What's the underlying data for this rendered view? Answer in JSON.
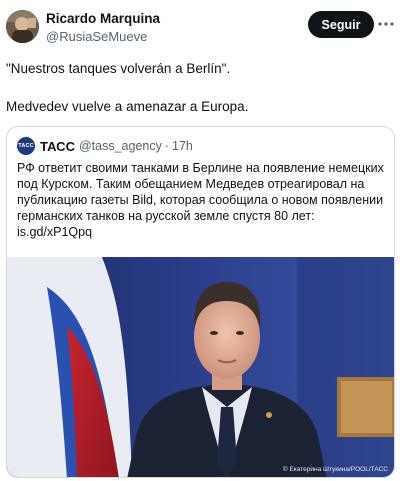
{
  "author": {
    "name": "Ricardo Marquina",
    "handle": "@RusiaSeMueve"
  },
  "follow_button": {
    "label": "Seguir"
  },
  "tweet": {
    "line1": "\"Nuestros tanques volverán a Berlín\".",
    "line2": "Medvedev vuelve a amenazar a Europa."
  },
  "quoted": {
    "avatar_text": "ТАСС",
    "name": "ТАСС",
    "handle": "@tass_agency",
    "separator": "·",
    "time": "17h",
    "text_lines": [
      "РФ ответит своими танками в Берлине на появление немецких",
      "под Курском. Таким обещанием Медведев отреагировал на",
      "публикацию газеты Bild, которая сообщила о новом появлении",
      "германских танков на русской земле спустя 80 лет:",
      "is.gd/xP1Qpq"
    ],
    "photo_credit": "© Екатерина Штукина/POOL/ТАСС"
  },
  "icons": {
    "avatar": "profile-photo",
    "more": "more-horizontal-icon",
    "tass_logo": "tass-logo-icon"
  },
  "colors": {
    "follow_bg": "#0f1419",
    "secondary_text": "#536471",
    "card_border": "#cfd9de",
    "tass_blue": "#1d3a7a"
  }
}
